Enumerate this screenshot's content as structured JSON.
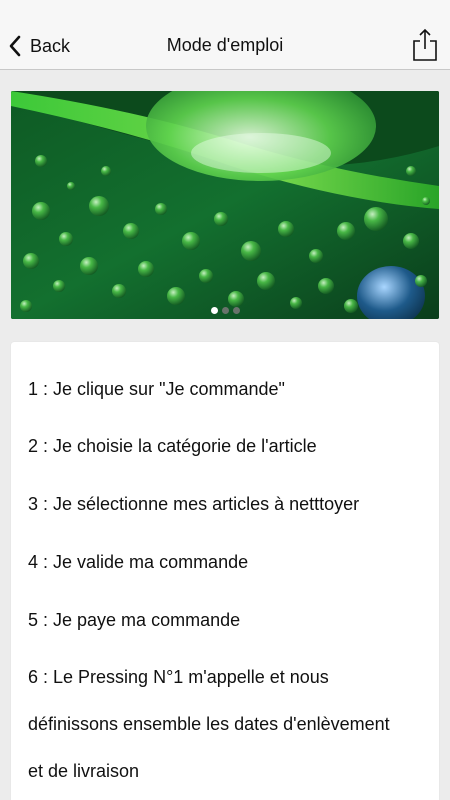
{
  "nav": {
    "back_label": "Back",
    "title": "Mode d'emploi",
    "back_icon": "chevron-left-icon",
    "share_icon": "share-icon"
  },
  "carousel": {
    "slide_count": 3,
    "active_index": 0
  },
  "steps": [
    "1 : Je clique sur \"Je commande\"",
    "2 : Je choisie la catégorie de l'article",
    "3 : Je sélectionne mes articles à netttoyer",
    "4 : Je valide ma commande",
    "5 : Je paye ma commande",
    "6 : Le Pressing N°1 m'appelle et nous",
    "définissons ensemble les dates d'enlèvement",
    "et de livraison"
  ],
  "colors": {
    "nav_background": "#f7f7f7",
    "page_background": "#ececec",
    "banner_green": "#1f8e3a"
  }
}
